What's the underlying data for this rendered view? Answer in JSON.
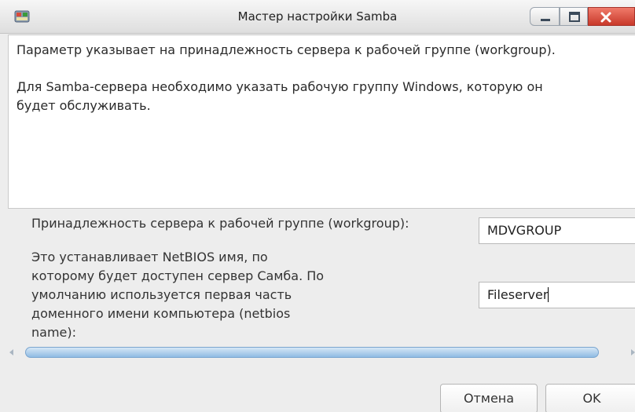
{
  "window": {
    "title": "Мастер настройки Samba",
    "app_icon": "samba-wizard-icon",
    "controls": [
      "minimize-icon",
      "maximize-icon",
      "close-icon"
    ],
    "accent_close": "#d24a3a"
  },
  "description": {
    "line1": "Параметр указывает на принадлежность сервера к рабочей группе (workgroup).",
    "line2": "Для Samba-сервера необходимо указать рабочую группу Windows, которую он",
    "line3": "будет обслуживать."
  },
  "form": {
    "workgroup_label": "Принадлежность сервера к рабочей группе (workgroup):",
    "workgroup_value": "MDVGROUP",
    "netbios_label_lines": [
      "Это устанавливает NetBIOS имя, по",
      "которому будет доступен сервер Самба. По",
      "умолчанию используется первая часть",
      "доменного имени компьютера (netbios",
      "name):"
    ],
    "netbios_value": "Fileserver"
  },
  "buttons": {
    "cancel": "Отмена",
    "ok": "OK"
  }
}
